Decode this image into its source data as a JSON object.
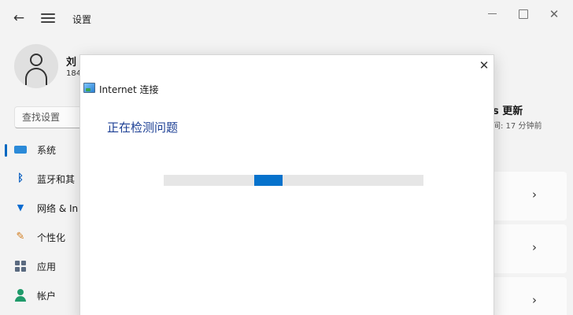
{
  "window": {
    "app_title": "设置",
    "back_icon": "back-arrow-icon",
    "menu_icon": "hamburger-menu-icon"
  },
  "user": {
    "name": "刘",
    "email": "184"
  },
  "search": {
    "placeholder": "查找设置"
  },
  "sidebar": {
    "items": [
      {
        "label": "系统",
        "icon": "monitor-icon",
        "selected": true
      },
      {
        "label": "蓝牙和其",
        "icon": "bluetooth-icon"
      },
      {
        "label": "网络 & In",
        "icon": "wifi-icon"
      },
      {
        "label": "个性化",
        "icon": "brush-icon"
      },
      {
        "label": "应用",
        "icon": "apps-icon"
      },
      {
        "label": "帐户",
        "icon": "account-icon"
      }
    ]
  },
  "update": {
    "title": "s 更新",
    "subtitle": "间: 17 分钟前"
  },
  "dialog": {
    "title": "Internet 连接",
    "heading": "正在检测问题",
    "progress_position": 0.39
  },
  "colors": {
    "accent": "#0067c0",
    "progress_fill": "#0672cc",
    "heading": "#1c3f94"
  }
}
